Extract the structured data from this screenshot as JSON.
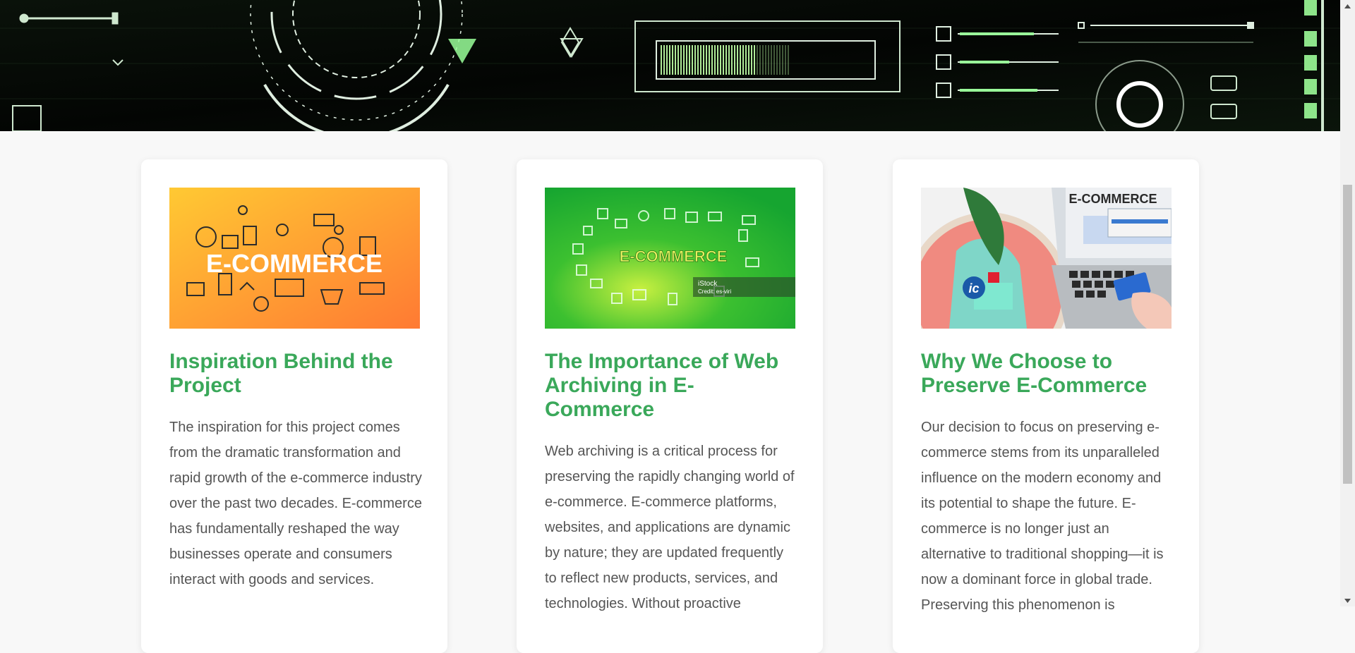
{
  "hero": {
    "banner_alt": "tech interface banner"
  },
  "cards": [
    {
      "image": {
        "label": "E-COMMERCE",
        "theme": "orange",
        "bg_from": "#ffc933",
        "bg_to": "#ff7a33"
      },
      "title": "Inspiration Behind the Project",
      "body": "The inspiration for this project comes from the dramatic transformation and rapid growth of the e-commerce industry over the past two decades. E-commerce has fundamentally reshaped the way businesses operate and consumers interact with goods and services."
    },
    {
      "image": {
        "label": "E-COMMERCE",
        "theme": "green",
        "bg_from": "#a8e040",
        "bg_to": "#16a530",
        "watermark_line1": "iStock",
        "watermark_line2": "Credit: es-viri"
      },
      "title": "The Importance of Web Archiving in E-Commerce",
      "body": "Web archiving is a critical process for preserving the rapidly changing world of e-commerce. E-commerce platforms, websites, and applications are dynamic by nature; they are updated frequently to reflect new products, services, and technologies. Without proactive"
    },
    {
      "image": {
        "label": "E-COMMERCE",
        "theme": "laptop",
        "badge": "ic"
      },
      "title": "Why We Choose to Preserve E-Commerce",
      "body": "Our decision to focus on preserving e-commerce stems from its unparalleled influence on the modern economy and its potential to shape the future. E-commerce is no longer just an alternative to traditional shopping—it is now a dominant force in global trade. Preserving this phenomenon is"
    }
  ],
  "colors": {
    "accent": "#3aa85a",
    "text": "#555555",
    "page_bg": "#f8f8f8",
    "hero_glow": "#a8ff9a"
  }
}
